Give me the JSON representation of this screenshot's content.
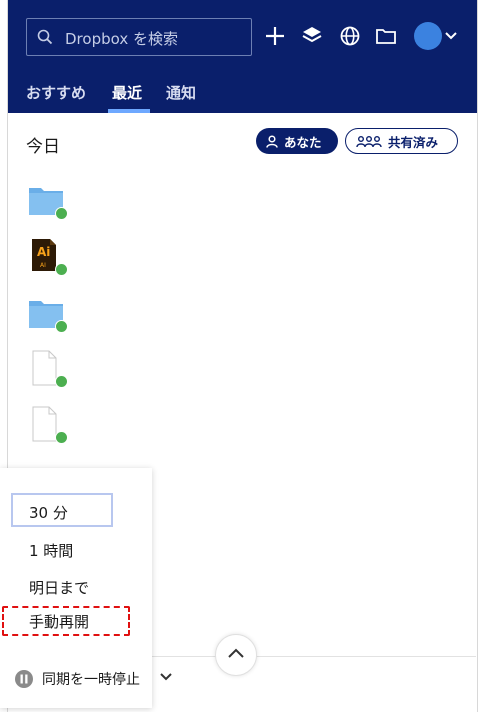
{
  "header": {
    "search_placeholder": "Dropbox を検索",
    "icons": [
      "plus-icon",
      "layers-icon",
      "globe-icon",
      "folder-icon"
    ],
    "avatar_color": "#3b82e0"
  },
  "tabs": [
    {
      "label": "おすすめ"
    },
    {
      "label": "最近"
    },
    {
      "label": "通知"
    }
  ],
  "recent": {
    "title": "今日",
    "filter_you": "あなた",
    "filter_shared": "共有済み",
    "files": [
      {
        "kind": "folder"
      },
      {
        "kind": "illustrator",
        "badge": "Ai",
        "sub": "AI"
      },
      {
        "kind": "folder"
      },
      {
        "kind": "document"
      },
      {
        "kind": "document"
      }
    ]
  },
  "pause_menu": {
    "options": [
      "30 分",
      "1 時間",
      "明日まで",
      "手動再開"
    ],
    "selected": "30 分",
    "highlighted": "手動再開",
    "pause_label": "同期を一時停止"
  },
  "colors": {
    "header_bg": "#0a1f6b",
    "accent": "#6ea8ff",
    "sync_ok": "#4caf50",
    "folder": "#6aaee8",
    "highlight": "#e01010"
  }
}
